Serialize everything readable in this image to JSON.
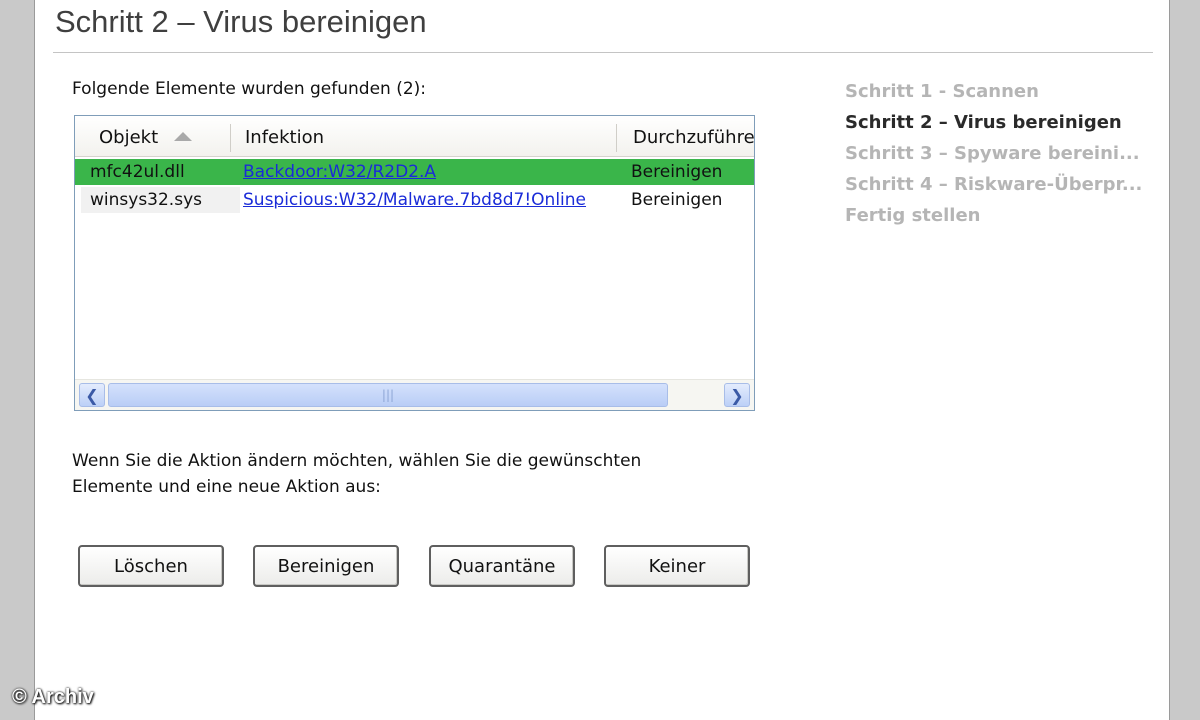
{
  "window": {
    "title": "Schritt 2 – Virus bereinigen"
  },
  "results": {
    "found_label": "Folgende Elemente wurden gefunden (2):",
    "columns": {
      "object": "Objekt",
      "infection": "Infektion",
      "action": "Durchzuführe"
    },
    "rows": [
      {
        "object": "mfc42ul.dll",
        "infection": "Backdoor:W32/R2D2.A",
        "action": "Bereinigen",
        "selected": true
      },
      {
        "object": "winsys32.sys",
        "infection": "Suspicious:W32/Malware.7bd8d7!Online",
        "action": "Bereinigen",
        "selected": false
      }
    ],
    "selected_row_color": "#3ab54a",
    "scroll_thumb_glyph": "|||"
  },
  "hint": {
    "line1": "Wenn Sie die Aktion ändern möchten, wählen Sie die gewünschten",
    "line2": "Elemente und eine neue Aktion aus:"
  },
  "actions": {
    "delete": "Löschen",
    "clean": "Bereinigen",
    "quarantine": "Quarantäne",
    "none": "Keiner"
  },
  "steps": [
    {
      "label": "Schritt 1 - Scannen",
      "active": false
    },
    {
      "label": "Schritt 2 – Virus bereinigen",
      "active": true
    },
    {
      "label": "Schritt 3 – Spyware bereini...",
      "active": false
    },
    {
      "label": "Schritt 4 – Riskware-Überpr...",
      "active": false
    },
    {
      "label": "Fertig stellen",
      "active": false
    }
  ],
  "watermark": "© Archiv",
  "icons": {
    "sort": "sort-ascending-icon",
    "scroll_left": "chevron-left-icon",
    "scroll_right": "chevron-right-icon",
    "current_step": "triangle-right-icon"
  }
}
